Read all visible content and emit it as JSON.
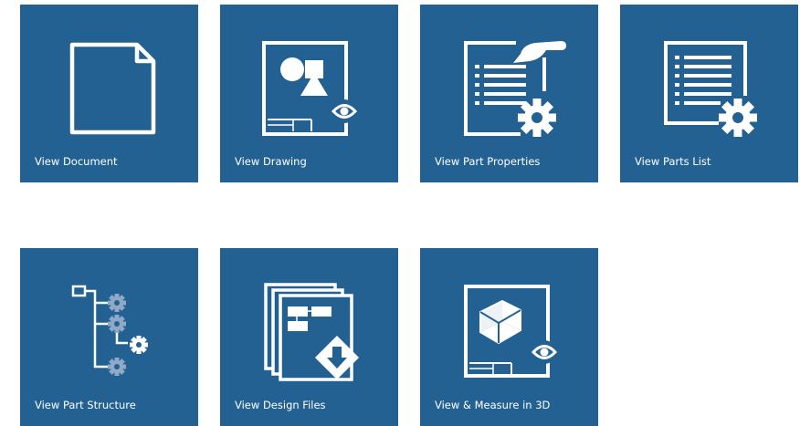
{
  "tiles": [
    {
      "label": "View Document",
      "icon": "document-icon"
    },
    {
      "label": "View Drawing",
      "icon": "drawing-view-icon"
    },
    {
      "label": "View Part Properties",
      "icon": "part-properties-icon"
    },
    {
      "label": "View Parts List",
      "icon": "parts-list-icon"
    },
    {
      "label": "View Part Structure",
      "icon": "part-structure-icon"
    },
    {
      "label": "View Design Files",
      "icon": "design-files-icon"
    },
    {
      "label": "View & Measure in 3D",
      "icon": "3d-measure-icon"
    }
  ],
  "colors": {
    "tile_background": "#236192",
    "foreground": "#ffffff",
    "accent_gear_muted": "#8fa9c6"
  }
}
